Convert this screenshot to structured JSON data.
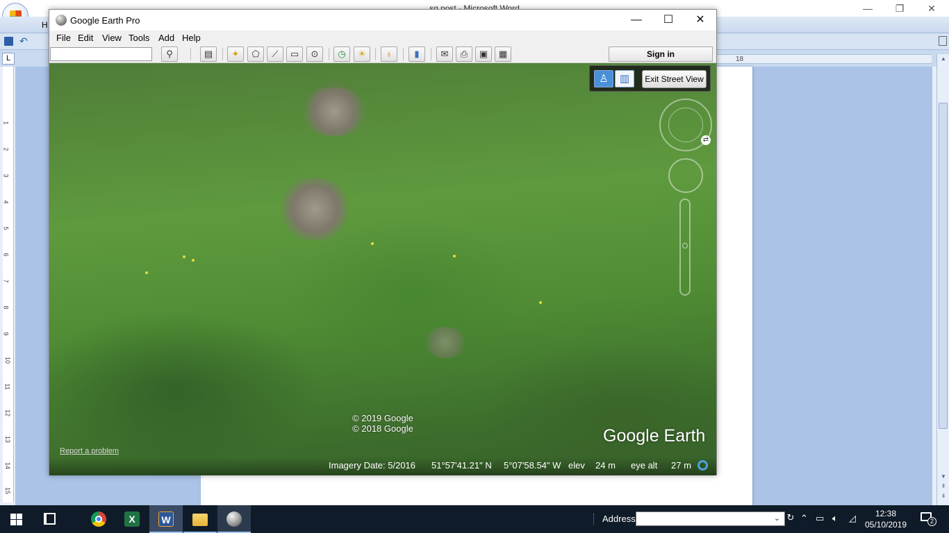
{
  "word": {
    "title": "sq post - Microsoft Word",
    "ribbon_tab_partial": "H",
    "ruler_tab_selector": "L",
    "ruler_right_label": "18",
    "vertical_ruler_numbers": [
      "1",
      "2",
      "3",
      "4",
      "5",
      "6",
      "7",
      "8",
      "9",
      "10",
      "11",
      "12",
      "13",
      "14",
      "15"
    ],
    "help_label": "?"
  },
  "google_earth": {
    "window_title": "Google Earth Pro",
    "menu": [
      "File",
      "Edit",
      "View",
      "Tools",
      "Add",
      "Help"
    ],
    "search_value": "",
    "sign_in_label": "Sign in",
    "street_view": {
      "exit_label": "Exit Street View"
    },
    "copyright_lines": [
      "© 2019 Google",
      "© 2018 Google"
    ],
    "logo_text": "Google Earth",
    "report_problem": "Report a problem",
    "status": {
      "imagery_date": "Imagery Date: 5/2016",
      "latitude": "51°57'41.21\" N",
      "longitude": "5°07'58.54\" W",
      "elev_label": "elev",
      "elev_value": "24 m",
      "eye_alt_label": "eye alt",
      "eye_alt_value": "27 m"
    }
  },
  "taskbar": {
    "apps": [
      "task-view",
      "chrome",
      "excel",
      "word",
      "file-explorer",
      "google-earth"
    ],
    "address_label": "Address",
    "address_value": "",
    "time": "12:38",
    "date": "05/10/2019",
    "notification_count": "2"
  },
  "colors": {
    "taskbar": "#101b29",
    "word_page_area": "#abc3e6",
    "street_view_blue": "#4a90d9",
    "status_ring": "#4aa3d8"
  }
}
